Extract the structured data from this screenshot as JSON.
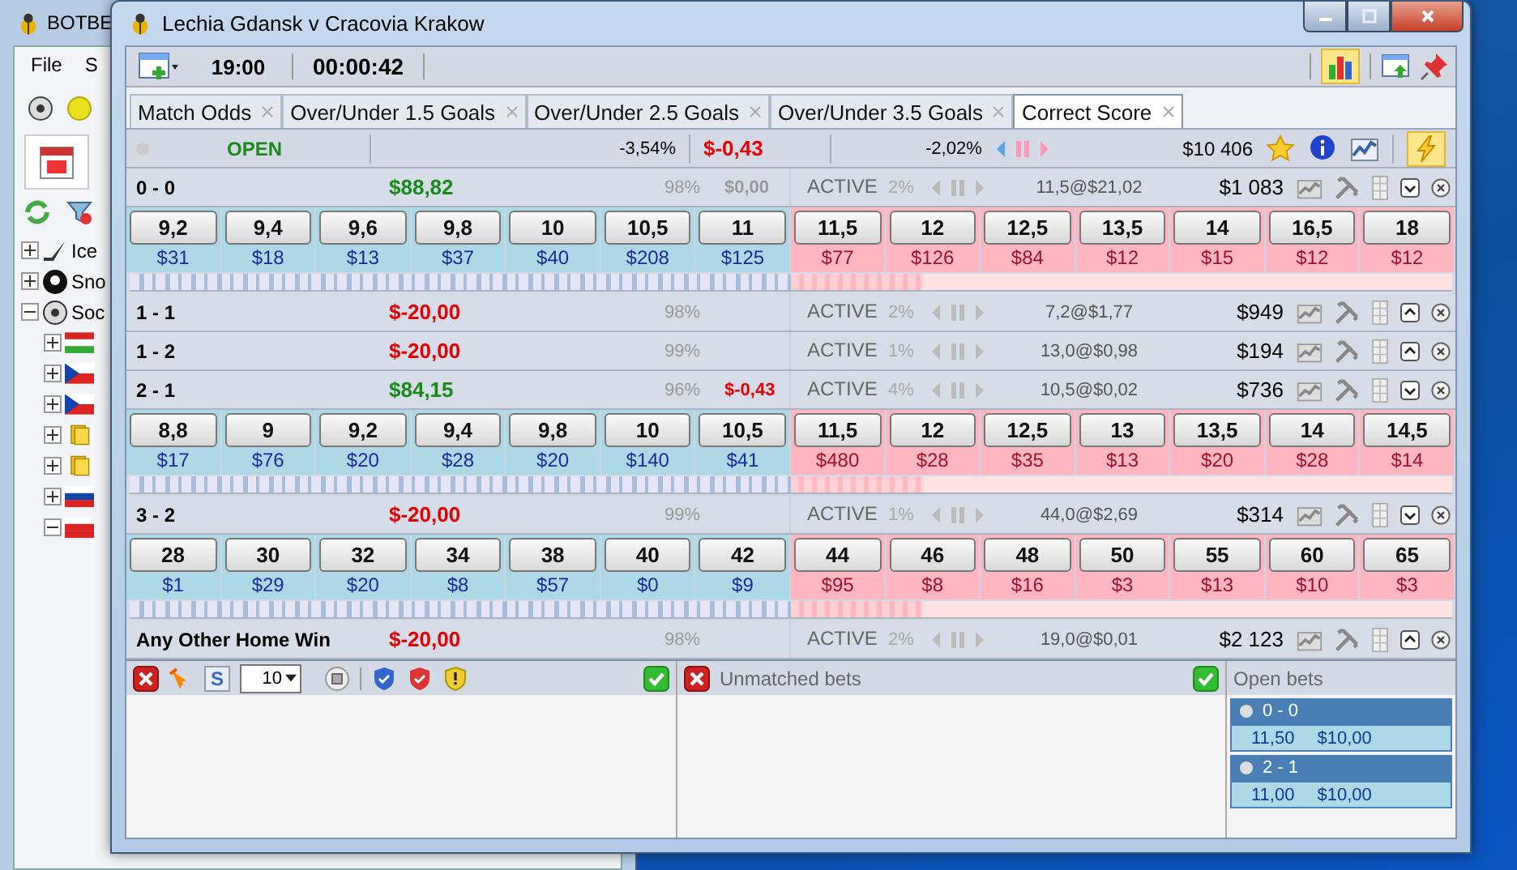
{
  "background_window": {
    "title": "BOTBE",
    "menu": [
      "File",
      "S"
    ],
    "tree": [
      {
        "label": "Ice",
        "kind": "hockey",
        "expanded": false
      },
      {
        "label": "Sno",
        "kind": "snooker",
        "expanded": false
      },
      {
        "label": "Soc",
        "kind": "soccer",
        "expanded": true,
        "children": [
          {
            "kind": "hu",
            "expanded": false
          },
          {
            "kind": "cz",
            "expanded": false
          },
          {
            "kind": "cz",
            "expanded": false
          },
          {
            "kind": "folder",
            "expanded": false
          },
          {
            "kind": "folder",
            "expanded": false
          },
          {
            "kind": "si",
            "expanded": false
          },
          {
            "kind": "pl",
            "expanded": true
          }
        ]
      }
    ]
  },
  "window": {
    "title": "Lechia Gdansk v Cracovia Krakow"
  },
  "toolbar": {
    "start_time": "19:00",
    "elapsed": "00:00:42",
    "chart_view_on": true
  },
  "tabs": [
    {
      "label": "Match Odds",
      "selected": false
    },
    {
      "label": "Over/Under 1.5 Goals",
      "selected": false
    },
    {
      "label": "Over/Under 2.5 Goals",
      "selected": false
    },
    {
      "label": "Over/Under 3.5 Goals",
      "selected": false
    },
    {
      "label": "Correct Score",
      "selected": true
    }
  ],
  "market": {
    "status": "OPEN",
    "back_book": "-3,54%",
    "pnl": "$-0,43",
    "lay_book": "-2,02%",
    "matched": "$10 406",
    "auto_on": true
  },
  "selections": [
    {
      "name": "0 - 0",
      "pnl": "$88,82",
      "positive": true,
      "chance": "98%",
      "extra": {
        "text": "$0,00",
        "negative": false
      },
      "status": "ACTIVE",
      "share": "2%",
      "last_bet": "11,5@$21,02",
      "matched": "$1 083",
      "expanded": true,
      "back": [
        {
          "price": "9,2",
          "amount": "$31"
        },
        {
          "price": "9,4",
          "amount": "$18"
        },
        {
          "price": "9,6",
          "amount": "$13"
        },
        {
          "price": "9,8",
          "amount": "$37"
        },
        {
          "price": "10",
          "amount": "$40"
        },
        {
          "price": "10,5",
          "amount": "$208"
        },
        {
          "price": "11",
          "amount": "$125"
        }
      ],
      "lay": [
        {
          "price": "11,5",
          "amount": "$77"
        },
        {
          "price": "12",
          "amount": "$126"
        },
        {
          "price": "12,5",
          "amount": "$84"
        },
        {
          "price": "13,5",
          "amount": "$12"
        },
        {
          "price": "14",
          "amount": "$15"
        },
        {
          "price": "16,5",
          "amount": "$12"
        },
        {
          "price": "18",
          "amount": "$12"
        }
      ]
    },
    {
      "name": "1 - 1",
      "pnl": "$-20,00",
      "positive": false,
      "chance": "98%",
      "status": "ACTIVE",
      "share": "2%",
      "last_bet": "7,2@$1,77",
      "matched": "$949",
      "expanded": false
    },
    {
      "name": "1 - 2",
      "pnl": "$-20,00",
      "positive": false,
      "chance": "99%",
      "status": "ACTIVE",
      "share": "1%",
      "last_bet": "13,0@$0,98",
      "matched": "$194",
      "expanded": false
    },
    {
      "name": "2 - 1",
      "pnl": "$84,15",
      "positive": true,
      "chance": "96%",
      "extra": {
        "text": "$-0,43",
        "negative": true
      },
      "status": "ACTIVE",
      "share": "4%",
      "last_bet": "10,5@$0,02",
      "matched": "$736",
      "expanded": true,
      "back": [
        {
          "price": "8,8",
          "amount": "$17"
        },
        {
          "price": "9",
          "amount": "$76"
        },
        {
          "price": "9,2",
          "amount": "$20"
        },
        {
          "price": "9,4",
          "amount": "$28"
        },
        {
          "price": "9,8",
          "amount": "$20"
        },
        {
          "price": "10",
          "amount": "$140"
        },
        {
          "price": "10,5",
          "amount": "$41"
        }
      ],
      "lay": [
        {
          "price": "11,5",
          "amount": "$480"
        },
        {
          "price": "12",
          "amount": "$28"
        },
        {
          "price": "12,5",
          "amount": "$35"
        },
        {
          "price": "13",
          "amount": "$13"
        },
        {
          "price": "13,5",
          "amount": "$20"
        },
        {
          "price": "14",
          "amount": "$28"
        },
        {
          "price": "14,5",
          "amount": "$14"
        }
      ]
    },
    {
      "name": "3 - 2",
      "pnl": "$-20,00",
      "positive": false,
      "chance": "99%",
      "status": "ACTIVE",
      "share": "1%",
      "last_bet": "44,0@$2,69",
      "matched": "$314",
      "expanded": true,
      "back": [
        {
          "price": "28",
          "amount": "$1"
        },
        {
          "price": "30",
          "amount": "$29"
        },
        {
          "price": "32",
          "amount": "$20"
        },
        {
          "price": "34",
          "amount": "$8"
        },
        {
          "price": "38",
          "amount": "$57"
        },
        {
          "price": "40",
          "amount": "$0"
        },
        {
          "price": "42",
          "amount": "$9"
        }
      ],
      "lay": [
        {
          "price": "44",
          "amount": "$95"
        },
        {
          "price": "46",
          "amount": "$8"
        },
        {
          "price": "48",
          "amount": "$16"
        },
        {
          "price": "50",
          "amount": "$3"
        },
        {
          "price": "55",
          "amount": "$13"
        },
        {
          "price": "60",
          "amount": "$10"
        },
        {
          "price": "65",
          "amount": "$3"
        }
      ]
    },
    {
      "name": "Any Other Home Win",
      "pnl": "$-20,00",
      "positive": false,
      "chance": "98%",
      "status": "ACTIVE",
      "share": "2%",
      "last_bet": "19,0@$0,01",
      "matched": "$2 123",
      "expanded": false
    }
  ],
  "bet_tools": {
    "s_label": "S",
    "stake": "10"
  },
  "unmatched": {
    "title": "Unmatched bets"
  },
  "open_bets": {
    "title": "Open bets",
    "bets": [
      {
        "selection": "0 - 0",
        "odds": "11,50",
        "stake": "$10,00"
      },
      {
        "selection": "2 - 1",
        "odds": "11,00",
        "stake": "$10,00"
      }
    ]
  }
}
